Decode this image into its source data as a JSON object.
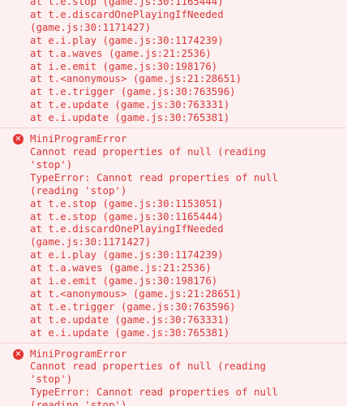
{
  "console": {
    "entries": [
      {
        "title": "",
        "lines": [
          "at t.e.stop (game.js:30:1165444)",
          "at t.e.discardOnePlayingIfNeeded",
          "(game.js:30:1171427)",
          "at e.i.play (game.js:30:1174239)",
          "at t.a.waves (game.js:21:2536)",
          "at i.e.emit (game.js:30:198176)",
          "at t.<anonymous> (game.js:21:28651)",
          "at t.e.trigger (game.js:30:763596)",
          "at t.e.update (game.js:30:763331)",
          "at e.i.update (game.js:30:765381)"
        ]
      },
      {
        "title": "MiniProgramError",
        "lines": [
          "Cannot read properties of null (reading",
          "'stop')",
          "TypeError: Cannot read properties of null",
          "(reading 'stop')",
          "at t.e.stop (game.js:30:1153051)",
          "at t.e.stop (game.js:30:1165444)",
          "at t.e.discardOnePlayingIfNeeded",
          "(game.js:30:1171427)",
          "at e.i.play (game.js:30:1174239)",
          "at t.a.waves (game.js:21:2536)",
          "at i.e.emit (game.js:30:198176)",
          "at t.<anonymous> (game.js:21:28651)",
          "at t.e.trigger (game.js:30:763596)",
          "at t.e.update (game.js:30:763331)",
          "at e.i.update (game.js:30:765381)"
        ]
      },
      {
        "title": "MiniProgramError",
        "lines": [
          "Cannot read properties of null (reading",
          "'stop')",
          "TypeError: Cannot read properties of null",
          "(reading 'stop')"
        ]
      }
    ]
  },
  "icons": {
    "error_icon_glyph": "✕"
  },
  "colors": {
    "error_text": "#d9383a",
    "error_background": "#fdf0f0",
    "divider": "#f3cfcf",
    "error_icon": "#e3342f"
  }
}
